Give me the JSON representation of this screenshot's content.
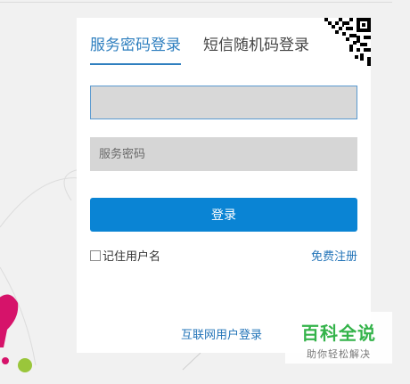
{
  "tabs": {
    "service_password": "服务密码登录",
    "sms_code": "短信随机码登录"
  },
  "fields": {
    "account_value": "",
    "password_placeholder": "服务密码"
  },
  "login_button": "登录",
  "remember_label": "记住用户名",
  "register_link": "免费注册",
  "internet_login_link": "互联网用户登录",
  "watermark": {
    "title": "百科全说",
    "subtitle": "助你轻松解决"
  },
  "icons": {
    "qr": "qr-code-icon"
  },
  "colors": {
    "accent": "#2f7fbf",
    "button": "#0a84d4",
    "link": "#2374b8",
    "watermark_green": "#34b34a"
  }
}
